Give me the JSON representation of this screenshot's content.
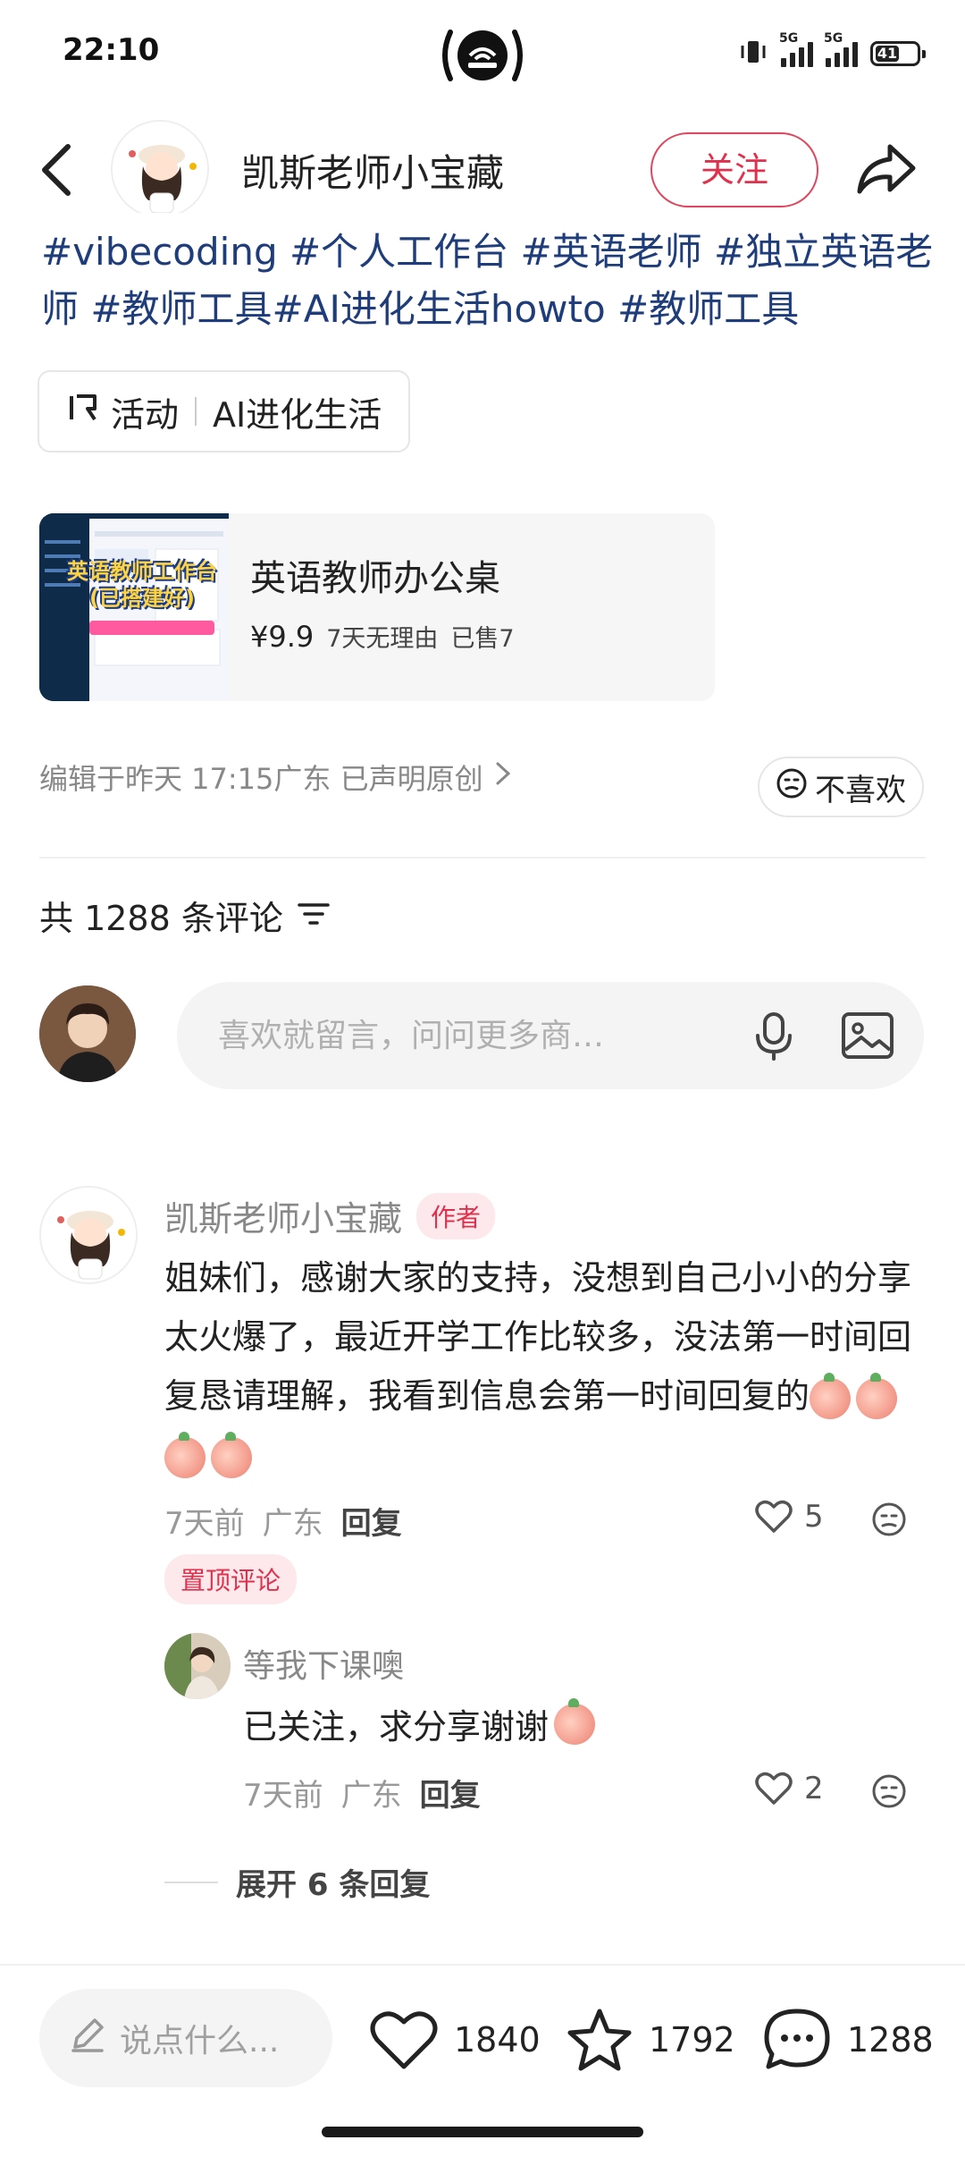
{
  "status_bar": {
    "time": "22:10",
    "network_1": "5G",
    "network_2": "5G",
    "battery": "41"
  },
  "header": {
    "author_name": "凯斯老师小宝藏",
    "follow_label": "关注"
  },
  "post": {
    "hashtags": "#vibecoding #个人工作台 #英语老师 #独立英语老师 #教师工具#AI进化生活howto #教师工具",
    "activity_label": "活动",
    "activity_name": "AI进化生活"
  },
  "product": {
    "thumb_text": "英语教师工作台 (已搭建好)",
    "title": "英语教师办公桌",
    "price": "¥9.9",
    "return_policy": "7天无理由",
    "sold": "已售7"
  },
  "edit_info": "编辑于昨天 17:15广东 已声明原创",
  "dislike_label": "不喜欢",
  "comments": {
    "count_label": "共 1288 条评论",
    "input_placeholder": "喜欢就留言，问问更多商…",
    "items": [
      {
        "user": "凯斯老师小宝藏",
        "badge": "作者",
        "text": "姐妹们，感谢大家的支持，没想到自己小小的分享太火爆了，最近开学工作比较多，没法第一时间回复恳请理解，我看到信息会第一时间回复的",
        "time": "7天前",
        "location": "广东",
        "reply_label": "回复",
        "likes": "5",
        "pinned_label": "置顶评论",
        "replies": [
          {
            "user": "等我下课噢",
            "text": "已关注，求分享谢谢",
            "time": "7天前",
            "location": "广东",
            "reply_label": "回复",
            "likes": "2"
          }
        ],
        "expand_label": "展开 6 条回复"
      }
    ]
  },
  "bottom_bar": {
    "say_placeholder": "说点什么...",
    "likes": "1840",
    "favorites": "1792",
    "comments": "1288"
  },
  "colors": {
    "accent": "#e0304c",
    "hashtag": "#1f3d7a",
    "muted": "#888888"
  }
}
